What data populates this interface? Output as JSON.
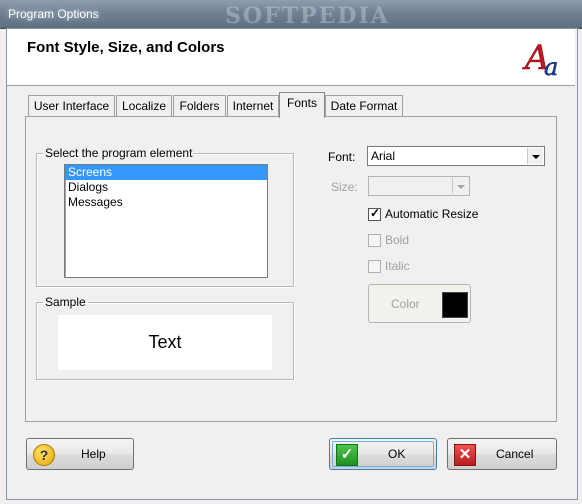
{
  "window": {
    "title": "Program Options",
    "watermark": "SOFTPEDIA"
  },
  "header": {
    "title": "Font Style, Size, and Colors",
    "logo_text": "Aa",
    "logo_icon": "font-aa-icon"
  },
  "tabs": [
    {
      "label": "User Interface",
      "active": false
    },
    {
      "label": "Localize",
      "active": false
    },
    {
      "label": "Folders",
      "active": false
    },
    {
      "label": "Internet",
      "active": false
    },
    {
      "label": "Fonts",
      "active": true
    },
    {
      "label": "Date Format",
      "active": false
    }
  ],
  "element_group": {
    "legend": "Select the program element",
    "items": [
      "Screens",
      "Dialogs",
      "Messages"
    ],
    "selected": "Screens"
  },
  "sample_group": {
    "legend": "Sample",
    "text": "Text"
  },
  "font": {
    "label": "Font:",
    "value": "Arial"
  },
  "size": {
    "label": "Size:",
    "value": ""
  },
  "options": {
    "auto_resize": {
      "label": "Automatic Resize",
      "checked": true,
      "enabled": true
    },
    "bold": {
      "label": "Bold",
      "checked": false,
      "enabled": false
    },
    "italic": {
      "label": "Italic",
      "checked": false,
      "enabled": false
    }
  },
  "color": {
    "label": "Color",
    "value": "#000000"
  },
  "buttons": {
    "help": "Help",
    "ok": "OK",
    "cancel": "Cancel"
  },
  "colors": {
    "selection": "#3399ff",
    "titlebar": "#6f8193",
    "ok_icon": "#2fa52f",
    "cancel_icon": "#d43232",
    "help_icon": "#f0b800"
  }
}
